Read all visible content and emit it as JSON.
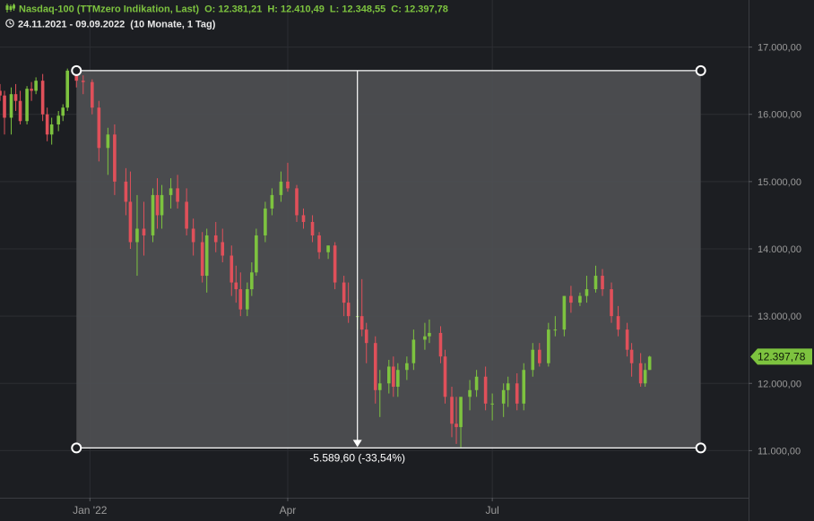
{
  "header": {
    "instrument": "Nasdaq-100 (TTMzero Indikation, Last)",
    "open": "O: 12.381,21",
    "high": "H: 12.410,49",
    "low": "L: 12.348,55",
    "close": "C: 12.397,78",
    "range": "24.11.2021 - 09.09.2022",
    "period": "(10 Monate, 1 Tag)",
    "instrument_icon": "candles-icon",
    "range_icon": "clock-icon"
  },
  "colors": {
    "background": "#1c1e22",
    "grid": "#2c2e33",
    "up": "#7dc33f",
    "down": "#e0505a",
    "selection": "#4e4f53",
    "axis_text": "#9a9a9a",
    "last_price_bg": "#7dc33f"
  },
  "chart_data": {
    "type": "candlestick",
    "x_tick_labels": [
      "Jan '22",
      "Apr",
      "Jul"
    ],
    "x_tick_dates": [
      "2022-01-03",
      "2022-04-01",
      "2022-07-01"
    ],
    "y_ticks": [
      11000,
      12000,
      13000,
      14000,
      15000,
      16000,
      17000
    ],
    "y_tick_labels": [
      "11.000,00",
      "12.000,00",
      "13.000,00",
      "14.000,00",
      "15.000,00",
      "16.000,00",
      "17.000,00"
    ],
    "ylim": [
      10300,
      17700
    ],
    "xlim": [
      "2021-11-24",
      "2022-10-23"
    ],
    "grid": true,
    "last_price": 12397.78,
    "last_price_label": "12.397,78",
    "measurement": {
      "start_date": "2021-12-28",
      "end_date": "2022-09-09",
      "high_value": 16650,
      "low_value": 11040,
      "arrow_date": "2022-05-02",
      "label": "-5.589,60 (-33,54%)"
    },
    "series": [
      {
        "dates": [
          "2021-11-24",
          "2021-11-26",
          "2021-11-29",
          "2021-12-01",
          "2021-12-03",
          "2021-12-06",
          "2021-12-08",
          "2021-12-10",
          "2021-12-13",
          "2021-12-15",
          "2021-12-17",
          "2021-12-20",
          "2021-12-22",
          "2021-12-24",
          "2021-12-28",
          "2021-12-31",
          "2022-01-04",
          "2022-01-07",
          "2022-01-11",
          "2022-01-14",
          "2022-01-19",
          "2022-01-21",
          "2022-01-24",
          "2022-01-27",
          "2022-01-31",
          "2022-02-02",
          "2022-02-04",
          "2022-02-08",
          "2022-02-11",
          "2022-02-15",
          "2022-02-18",
          "2022-02-22",
          "2022-02-24",
          "2022-02-28",
          "2022-03-03",
          "2022-03-07",
          "2022-03-09",
          "2022-03-11",
          "2022-03-14",
          "2022-03-16",
          "2022-03-18",
          "2022-03-22",
          "2022-03-25",
          "2022-03-29",
          "2022-04-01",
          "2022-04-05",
          "2022-04-08",
          "2022-04-12",
          "2022-04-15",
          "2022-04-19",
          "2022-04-22",
          "2022-04-26",
          "2022-04-28",
          "2022-05-02",
          "2022-05-04",
          "2022-05-06",
          "2022-05-10",
          "2022-05-12",
          "2022-05-16",
          "2022-05-18",
          "2022-05-20",
          "2022-05-24",
          "2022-05-27",
          "2022-06-01",
          "2022-06-03",
          "2022-06-08",
          "2022-06-10",
          "2022-06-13",
          "2022-06-15",
          "2022-06-17",
          "2022-06-21",
          "2022-06-24",
          "2022-06-28",
          "2022-07-01",
          "2022-07-06",
          "2022-07-08",
          "2022-07-12",
          "2022-07-15",
          "2022-07-19",
          "2022-07-22",
          "2022-07-26",
          "2022-07-29",
          "2022-08-02",
          "2022-08-05",
          "2022-08-09",
          "2022-08-12",
          "2022-08-16",
          "2022-08-19",
          "2022-08-23",
          "2022-08-26",
          "2022-08-30",
          "2022-09-01",
          "2022-09-05",
          "2022-09-07",
          "2022-09-09"
        ],
        "open": [
          16350,
          16280,
          15950,
          16300,
          16200,
          15900,
          16380,
          16350,
          16500,
          16000,
          15700,
          15850,
          15980,
          16100,
          16650,
          16500,
          16480,
          16100,
          15500,
          15700,
          15000,
          14700,
          14100,
          14300,
          14200,
          14800,
          14500,
          14800,
          14900,
          14700,
          14300,
          14100,
          13600,
          14200,
          14100,
          13900,
          13500,
          13400,
          13100,
          13400,
          13650,
          14200,
          14600,
          14800,
          15000,
          14900,
          14500,
          14400,
          14200,
          13950,
          14050,
          13500,
          13200,
          13000,
          13000,
          12800,
          12600,
          11900,
          12000,
          12250,
          11950,
          12200,
          12300,
          12650,
          12700,
          12750,
          12400,
          11800,
          11400,
          11350,
          11800,
          11900,
          12100,
          11700,
          11700,
          11900,
          12000,
          11700,
          12200,
          12500,
          12300,
          12800,
          12800,
          13300,
          13200,
          13300,
          13400,
          13600,
          13400,
          13000,
          12800,
          12500,
          12300,
          12000,
          12200
        ],
        "high": [
          16450,
          16350,
          16400,
          16450,
          16350,
          16420,
          16480,
          16550,
          16600,
          16100,
          15950,
          16050,
          16150,
          16680,
          16680,
          16580,
          16520,
          16200,
          15800,
          15850,
          15200,
          15150,
          14800,
          14700,
          14900,
          15050,
          14950,
          15050,
          15100,
          14900,
          14450,
          14250,
          14300,
          14400,
          14300,
          14050,
          13750,
          13650,
          13500,
          13800,
          14300,
          14700,
          14900,
          15150,
          15280,
          14950,
          14600,
          14500,
          14250,
          14050,
          14100,
          13600,
          13500,
          13250,
          13550,
          12900,
          12700,
          12200,
          12350,
          12400,
          12300,
          12400,
          12800,
          12900,
          12950,
          12850,
          12500,
          11950,
          11800,
          11600,
          12050,
          12200,
          12250,
          11850,
          12000,
          12100,
          12150,
          12300,
          12600,
          12600,
          12900,
          13000,
          13300,
          13450,
          13350,
          13600,
          13750,
          13700,
          13500,
          13150,
          12900,
          12600,
          12450,
          12300,
          12410
        ],
        "low": [
          16200,
          15700,
          15700,
          16050,
          15850,
          15850,
          16200,
          16300,
          15900,
          15600,
          15550,
          15750,
          15900,
          16050,
          16400,
          16300,
          16000,
          15300,
          15100,
          14800,
          14500,
          14000,
          13600,
          13900,
          14100,
          14300,
          14300,
          14600,
          14600,
          14200,
          13900,
          13500,
          13350,
          13950,
          13800,
          13300,
          13200,
          13000,
          13000,
          13300,
          13600,
          14100,
          14500,
          14700,
          14850,
          14400,
          14300,
          14100,
          13850,
          13850,
          13400,
          13000,
          12900,
          12800,
          12700,
          12300,
          11700,
          11500,
          11850,
          11800,
          11800,
          12050,
          12200,
          12500,
          12600,
          12300,
          11700,
          11200,
          11100,
          11050,
          11600,
          11800,
          11600,
          11450,
          11500,
          11650,
          11600,
          11600,
          12100,
          12250,
          12250,
          12700,
          12700,
          13050,
          13150,
          13200,
          13350,
          13300,
          12900,
          12700,
          12400,
          12100,
          11950,
          11950,
          12200
        ],
        "close": [
          16280,
          15950,
          16300,
          16200,
          15900,
          16380,
          16350,
          16500,
          16000,
          15700,
          15850,
          15980,
          16100,
          16650,
          16500,
          16480,
          16100,
          15500,
          15700,
          15000,
          14700,
          14100,
          14300,
          14200,
          14800,
          14500,
          14800,
          14900,
          14700,
          14300,
          14100,
          13600,
          14200,
          14100,
          13900,
          13500,
          13400,
          13100,
          13400,
          13650,
          14200,
          14600,
          14800,
          15000,
          14900,
          14500,
          14400,
          14200,
          13950,
          14050,
          13500,
          13200,
          13000,
          13000,
          12800,
          12600,
          11900,
          12000,
          12250,
          11950,
          12200,
          12300,
          12650,
          12700,
          12750,
          12400,
          11800,
          11400,
          11350,
          11800,
          11900,
          12100,
          11700,
          11700,
          11900,
          12000,
          11700,
          12200,
          12500,
          12300,
          12800,
          12800,
          13300,
          13200,
          13300,
          13400,
          13600,
          13400,
          13000,
          12800,
          12500,
          12300,
          12000,
          12200,
          12397.78
        ]
      }
    ]
  }
}
